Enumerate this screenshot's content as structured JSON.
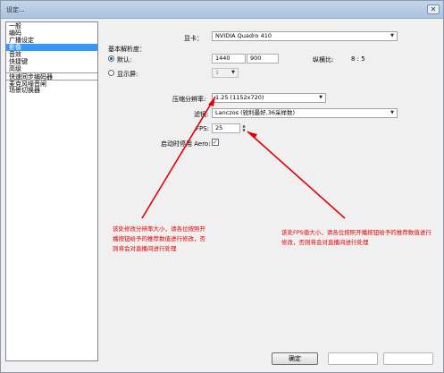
{
  "window": {
    "title": "设定...",
    "close_glyph": "✕"
  },
  "sidebar": {
    "items": [
      {
        "label": "一般"
      },
      {
        "label": "编码"
      },
      {
        "label": "广播设定"
      },
      {
        "label": "影像"
      },
      {
        "label": "音效"
      },
      {
        "label": "快捷键"
      },
      {
        "label": "高级"
      },
      {
        "label": "快速同步编码器"
      },
      {
        "label": "麦克风噪音闸"
      },
      {
        "label": "场景切换器"
      }
    ],
    "selected": "影像"
  },
  "video": {
    "adapter_label": "显卡：",
    "adapter_value": "NVIDIA Quadro 410",
    "base_res_label": "基本解析度：",
    "default_label": "默认:",
    "width_value": "1440",
    "height_value": "900",
    "aspect_label": "纵横比:",
    "aspect_value": "8 : 5",
    "monitor_label": "显示屏:",
    "monitor_value": "1",
    "downscale_label": "压缩分辨率:",
    "downscale_value": "1.25  (1152x720)",
    "filter_label": "滤镜:",
    "filter_value": "Lanczos (锐利最好,36采样数)",
    "fps_label": "FPS:",
    "fps_value": "25",
    "aero_label": "启动时停用 Aero:"
  },
  "annotations": {
    "left": "该处修改分辨率大小，请各位按照开播按钮给予的推荐数值进行修改，否则将会对直播间进行处理",
    "right": "该处FPS值大小，请各位按照开播按钮给予的推荐数值进行修改，否则将会对直播间进行处理",
    "color": "#e30000"
  },
  "buttons": {
    "ok_label": "确定"
  }
}
